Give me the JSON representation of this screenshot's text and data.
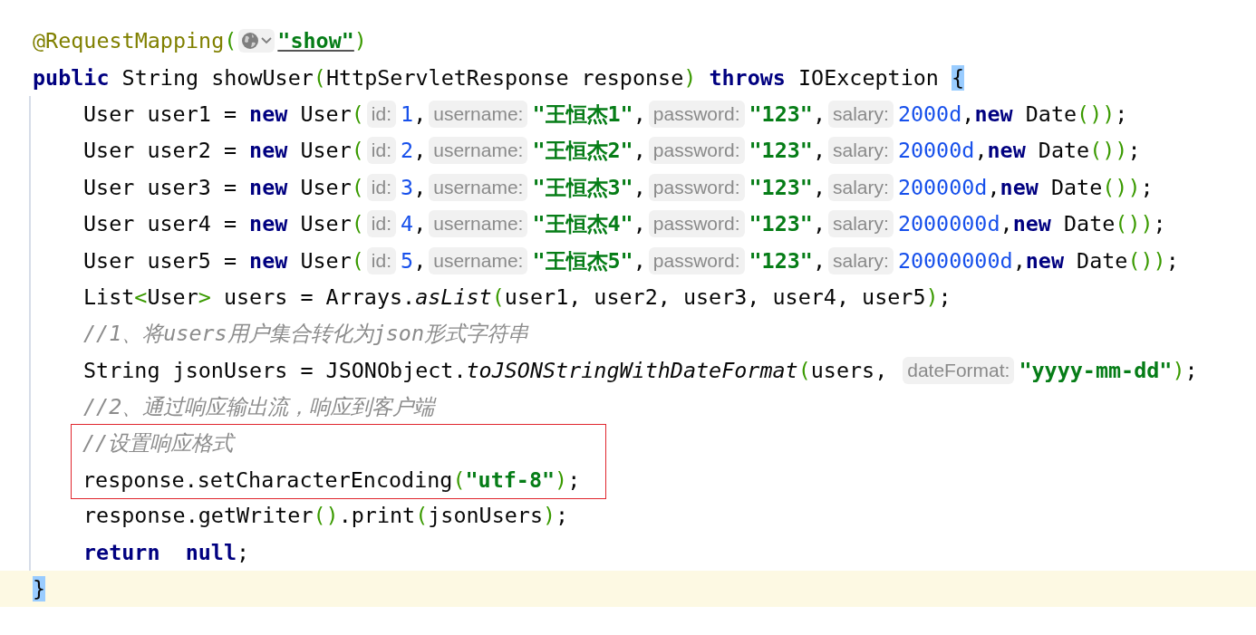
{
  "lines": [
    {
      "kind": "top",
      "boxed": false,
      "current": false,
      "parts": [
        {
          "kind": "code",
          "tokens": [
            {
              "kind": "ann",
              "text": "@RequestMapping"
            },
            {
              "kind": "paren",
              "text": "("
            }
          ]
        },
        {
          "kind": "url-hint"
        },
        {
          "kind": "code",
          "tokens": [
            {
              "kind": "link",
              "text": "\"show\""
            },
            {
              "kind": "paren",
              "text": ")"
            }
          ]
        }
      ]
    },
    {
      "kind": "top",
      "boxed": false,
      "current": false,
      "parts": [
        {
          "kind": "code",
          "tokens": [
            {
              "kind": "kw",
              "text": "public"
            },
            {
              "kind": "plain",
              "text": " String showUser"
            },
            {
              "kind": "paren",
              "text": "("
            },
            {
              "kind": "plain",
              "text": "HttpServletResponse response"
            },
            {
              "kind": "paren",
              "text": ")"
            },
            {
              "kind": "kw",
              "text": " throws"
            },
            {
              "kind": "plain",
              "text": " IOException "
            },
            {
              "kind": "brace",
              "text": "{"
            }
          ]
        }
      ]
    },
    {
      "kind": "body",
      "boxed": false,
      "current": false,
      "parts": [
        {
          "kind": "code",
          "tokens": [
            {
              "kind": "plain",
              "text": "User user1 = "
            },
            {
              "kind": "kw",
              "text": "new"
            },
            {
              "kind": "plain",
              "text": " User"
            },
            {
              "kind": "paren",
              "text": "("
            }
          ]
        },
        {
          "kind": "hint",
          "text": "id:"
        },
        {
          "kind": "code",
          "tokens": [
            {
              "kind": "num",
              "text": "1"
            },
            {
              "kind": "plain",
              "text": ","
            }
          ]
        },
        {
          "kind": "hint",
          "text": "username:"
        },
        {
          "kind": "code",
          "tokens": [
            {
              "kind": "str",
              "text": "\"王恒杰1\""
            },
            {
              "kind": "plain",
              "text": ","
            }
          ]
        },
        {
          "kind": "hint",
          "text": "password:"
        },
        {
          "kind": "code",
          "tokens": [
            {
              "kind": "str",
              "text": "\"123\""
            },
            {
              "kind": "plain",
              "text": ","
            }
          ]
        },
        {
          "kind": "hint",
          "text": "salary:"
        },
        {
          "kind": "code",
          "tokens": [
            {
              "kind": "num",
              "text": "2000d"
            },
            {
              "kind": "plain",
              "text": ","
            },
            {
              "kind": "kw",
              "text": "new"
            },
            {
              "kind": "plain",
              "text": " Date"
            },
            {
              "kind": "paren",
              "text": "()"
            },
            {
              "kind": "paren",
              "text": ")"
            },
            {
              "kind": "plain",
              "text": ";"
            }
          ]
        }
      ]
    },
    {
      "kind": "body",
      "boxed": false,
      "current": false,
      "parts": [
        {
          "kind": "code",
          "tokens": [
            {
              "kind": "plain",
              "text": "User user2 = "
            },
            {
              "kind": "kw",
              "text": "new"
            },
            {
              "kind": "plain",
              "text": " User"
            },
            {
              "kind": "paren",
              "text": "("
            }
          ]
        },
        {
          "kind": "hint",
          "text": "id:"
        },
        {
          "kind": "code",
          "tokens": [
            {
              "kind": "num",
              "text": "2"
            },
            {
              "kind": "plain",
              "text": ","
            }
          ]
        },
        {
          "kind": "hint",
          "text": "username:"
        },
        {
          "kind": "code",
          "tokens": [
            {
              "kind": "str",
              "text": "\"王恒杰2\""
            },
            {
              "kind": "plain",
              "text": ","
            }
          ]
        },
        {
          "kind": "hint",
          "text": "password:"
        },
        {
          "kind": "code",
          "tokens": [
            {
              "kind": "str",
              "text": "\"123\""
            },
            {
              "kind": "plain",
              "text": ","
            }
          ]
        },
        {
          "kind": "hint",
          "text": "salary:"
        },
        {
          "kind": "code",
          "tokens": [
            {
              "kind": "num",
              "text": "20000d"
            },
            {
              "kind": "plain",
              "text": ","
            },
            {
              "kind": "kw",
              "text": "new"
            },
            {
              "kind": "plain",
              "text": " Date"
            },
            {
              "kind": "paren",
              "text": "()"
            },
            {
              "kind": "paren",
              "text": ")"
            },
            {
              "kind": "plain",
              "text": ";"
            }
          ]
        }
      ]
    },
    {
      "kind": "body",
      "boxed": false,
      "current": false,
      "parts": [
        {
          "kind": "code",
          "tokens": [
            {
              "kind": "plain",
              "text": "User user3 = "
            },
            {
              "kind": "kw",
              "text": "new"
            },
            {
              "kind": "plain",
              "text": " User"
            },
            {
              "kind": "paren",
              "text": "("
            }
          ]
        },
        {
          "kind": "hint",
          "text": "id:"
        },
        {
          "kind": "code",
          "tokens": [
            {
              "kind": "num",
              "text": "3"
            },
            {
              "kind": "plain",
              "text": ","
            }
          ]
        },
        {
          "kind": "hint",
          "text": "username:"
        },
        {
          "kind": "code",
          "tokens": [
            {
              "kind": "str",
              "text": "\"王恒杰3\""
            },
            {
              "kind": "plain",
              "text": ","
            }
          ]
        },
        {
          "kind": "hint",
          "text": "password:"
        },
        {
          "kind": "code",
          "tokens": [
            {
              "kind": "str",
              "text": "\"123\""
            },
            {
              "kind": "plain",
              "text": ","
            }
          ]
        },
        {
          "kind": "hint",
          "text": "salary:"
        },
        {
          "kind": "code",
          "tokens": [
            {
              "kind": "num",
              "text": "200000d"
            },
            {
              "kind": "plain",
              "text": ","
            },
            {
              "kind": "kw",
              "text": "new"
            },
            {
              "kind": "plain",
              "text": " Date"
            },
            {
              "kind": "paren",
              "text": "()"
            },
            {
              "kind": "paren",
              "text": ")"
            },
            {
              "kind": "plain",
              "text": ";"
            }
          ]
        }
      ]
    },
    {
      "kind": "body",
      "boxed": false,
      "current": false,
      "parts": [
        {
          "kind": "code",
          "tokens": [
            {
              "kind": "plain",
              "text": "User user4 = "
            },
            {
              "kind": "kw",
              "text": "new"
            },
            {
              "kind": "plain",
              "text": " User"
            },
            {
              "kind": "paren",
              "text": "("
            }
          ]
        },
        {
          "kind": "hint",
          "text": "id:"
        },
        {
          "kind": "code",
          "tokens": [
            {
              "kind": "num",
              "text": "4"
            },
            {
              "kind": "plain",
              "text": ","
            }
          ]
        },
        {
          "kind": "hint",
          "text": "username:"
        },
        {
          "kind": "code",
          "tokens": [
            {
              "kind": "str",
              "text": "\"王恒杰4\""
            },
            {
              "kind": "plain",
              "text": ","
            }
          ]
        },
        {
          "kind": "hint",
          "text": "password:"
        },
        {
          "kind": "code",
          "tokens": [
            {
              "kind": "str",
              "text": "\"123\""
            },
            {
              "kind": "plain",
              "text": ","
            }
          ]
        },
        {
          "kind": "hint",
          "text": "salary:"
        },
        {
          "kind": "code",
          "tokens": [
            {
              "kind": "num",
              "text": "2000000d"
            },
            {
              "kind": "plain",
              "text": ","
            },
            {
              "kind": "kw",
              "text": "new"
            },
            {
              "kind": "plain",
              "text": " Date"
            },
            {
              "kind": "paren",
              "text": "()"
            },
            {
              "kind": "paren",
              "text": ")"
            },
            {
              "kind": "plain",
              "text": ";"
            }
          ]
        }
      ]
    },
    {
      "kind": "body",
      "boxed": false,
      "current": false,
      "parts": [
        {
          "kind": "code",
          "tokens": [
            {
              "kind": "plain",
              "text": "User user5 = "
            },
            {
              "kind": "kw",
              "text": "new"
            },
            {
              "kind": "plain",
              "text": " User"
            },
            {
              "kind": "paren",
              "text": "("
            }
          ]
        },
        {
          "kind": "hint",
          "text": "id:"
        },
        {
          "kind": "code",
          "tokens": [
            {
              "kind": "num",
              "text": "5"
            },
            {
              "kind": "plain",
              "text": ","
            }
          ]
        },
        {
          "kind": "hint",
          "text": "username:"
        },
        {
          "kind": "code",
          "tokens": [
            {
              "kind": "str",
              "text": "\"王恒杰5\""
            },
            {
              "kind": "plain",
              "text": ","
            }
          ]
        },
        {
          "kind": "hint",
          "text": "password:"
        },
        {
          "kind": "code",
          "tokens": [
            {
              "kind": "str",
              "text": "\"123\""
            },
            {
              "kind": "plain",
              "text": ","
            }
          ]
        },
        {
          "kind": "hint",
          "text": "salary:"
        },
        {
          "kind": "code",
          "tokens": [
            {
              "kind": "num",
              "text": "20000000d"
            },
            {
              "kind": "plain",
              "text": ","
            },
            {
              "kind": "kw",
              "text": "new"
            },
            {
              "kind": "plain",
              "text": " Date"
            },
            {
              "kind": "paren",
              "text": "()"
            },
            {
              "kind": "paren",
              "text": ")"
            },
            {
              "kind": "plain",
              "text": ";"
            }
          ]
        }
      ]
    },
    {
      "kind": "body",
      "boxed": false,
      "current": false,
      "parts": [
        {
          "kind": "code",
          "tokens": [
            {
              "kind": "plain",
              "text": "List"
            },
            {
              "kind": "paren",
              "text": "<"
            },
            {
              "kind": "plain",
              "text": "User"
            },
            {
              "kind": "paren",
              "text": ">"
            },
            {
              "kind": "plain",
              "text": " users = Arrays."
            },
            {
              "kind": "static",
              "text": "asList"
            },
            {
              "kind": "paren",
              "text": "("
            },
            {
              "kind": "plain",
              "text": "user1, user2, user3, user4, user5"
            },
            {
              "kind": "paren",
              "text": ")"
            },
            {
              "kind": "plain",
              "text": ";"
            }
          ]
        }
      ]
    },
    {
      "kind": "body",
      "boxed": false,
      "current": false,
      "parts": [
        {
          "kind": "code",
          "tokens": [
            {
              "kind": "comment",
              "text": "//1、将users用户集合转化为json形式字符串"
            }
          ]
        }
      ]
    },
    {
      "kind": "body",
      "boxed": false,
      "current": false,
      "parts": [
        {
          "kind": "code",
          "tokens": [
            {
              "kind": "plain",
              "text": "String jsonUsers = JSONObject."
            },
            {
              "kind": "static",
              "text": "toJSONStringWithDateFormat"
            },
            {
              "kind": "paren",
              "text": "("
            },
            {
              "kind": "plain",
              "text": "users,"
            }
          ]
        },
        {
          "kind": "hint",
          "text": "dateFormat:"
        },
        {
          "kind": "code",
          "tokens": [
            {
              "kind": "str",
              "text": "\"yyyy-mm-dd\""
            },
            {
              "kind": "paren",
              "text": ")"
            },
            {
              "kind": "plain",
              "text": ";"
            }
          ]
        }
      ]
    },
    {
      "kind": "body",
      "boxed": false,
      "current": false,
      "parts": [
        {
          "kind": "code",
          "tokens": [
            {
              "kind": "comment",
              "text": "//2、通过响应输出流，响应到客户端"
            }
          ]
        }
      ]
    },
    {
      "kind": "body",
      "boxed": true,
      "current": false,
      "parts": [
        {
          "kind": "code",
          "tokens": [
            {
              "kind": "comment",
              "text": "//设置响应格式"
            }
          ]
        }
      ]
    },
    {
      "kind": "body",
      "boxed": true,
      "current": false,
      "parts": [
        {
          "kind": "code",
          "tokens": [
            {
              "kind": "plain",
              "text": "response.setCharacterEncoding"
            },
            {
              "kind": "paren",
              "text": "("
            },
            {
              "kind": "str",
              "text": "\"utf-8\""
            },
            {
              "kind": "paren",
              "text": ")"
            },
            {
              "kind": "plain",
              "text": ";"
            }
          ]
        }
      ]
    },
    {
      "kind": "body",
      "boxed": false,
      "current": false,
      "parts": [
        {
          "kind": "code",
          "tokens": [
            {
              "kind": "plain",
              "text": "response.getWriter"
            },
            {
              "kind": "paren",
              "text": "()"
            },
            {
              "kind": "plain",
              "text": ".print"
            },
            {
              "kind": "paren",
              "text": "("
            },
            {
              "kind": "plain",
              "text": "jsonUsers"
            },
            {
              "kind": "paren",
              "text": ")"
            },
            {
              "kind": "plain",
              "text": ";"
            }
          ]
        }
      ]
    },
    {
      "kind": "body",
      "boxed": false,
      "current": false,
      "parts": [
        {
          "kind": "code",
          "tokens": [
            {
              "kind": "kw",
              "text": "return"
            },
            {
              "kind": "kw",
              "text": "  null"
            },
            {
              "kind": "plain",
              "text": ";"
            }
          ]
        }
      ]
    },
    {
      "kind": "top",
      "boxed": false,
      "current": true,
      "parts": [
        {
          "kind": "code",
          "tokens": [
            {
              "kind": "brace",
              "text": "}"
            }
          ]
        }
      ]
    }
  ]
}
